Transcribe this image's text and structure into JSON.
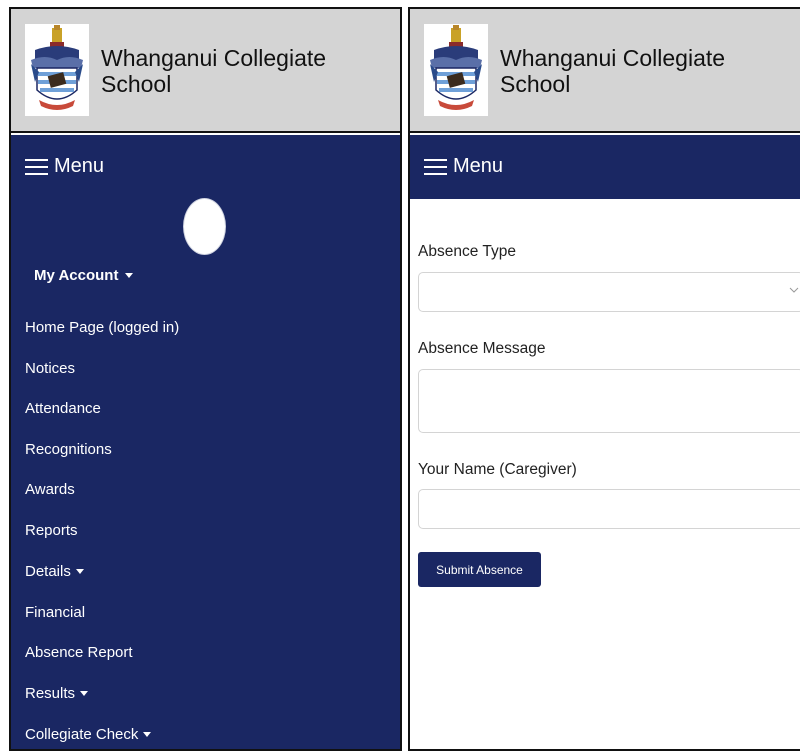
{
  "colors": {
    "brand_navy": "#1a2763",
    "header_gray": "#d4d4d4",
    "text_white": "#ffffff"
  },
  "left_panel": {
    "header": {
      "school_name": "Whanganui Collegiate School",
      "logo_icon": "school-crest-icon"
    },
    "menu": {
      "label": "Menu",
      "icon": "hamburger-icon"
    },
    "account": {
      "label": "My Account",
      "icon": "caret-down-icon"
    },
    "nav_items": [
      {
        "label": "Home Page (logged in)"
      },
      {
        "label": "Notices"
      },
      {
        "label": "Attendance"
      },
      {
        "label": "Recognitions"
      },
      {
        "label": "Awards"
      },
      {
        "label": "Reports"
      },
      {
        "label": "Details",
        "has_dropdown": true
      },
      {
        "label": "Financial"
      },
      {
        "label": "Absence Report"
      },
      {
        "label": "Results",
        "has_dropdown": true
      },
      {
        "label": "Collegiate Check",
        "has_dropdown": true
      }
    ]
  },
  "right_panel": {
    "header": {
      "school_name": "Whanganui Collegiate School",
      "logo_icon": "school-crest-icon"
    },
    "menu": {
      "label": "Menu",
      "icon": "hamburger-icon"
    },
    "form": {
      "absence_type_label": "Absence Type",
      "absence_type_value": "",
      "absence_message_label": "Absence Message",
      "absence_message_value": "",
      "caregiver_name_label": "Your Name (Caregiver)",
      "caregiver_name_value": "",
      "submit_label": "Submit Absence"
    }
  }
}
